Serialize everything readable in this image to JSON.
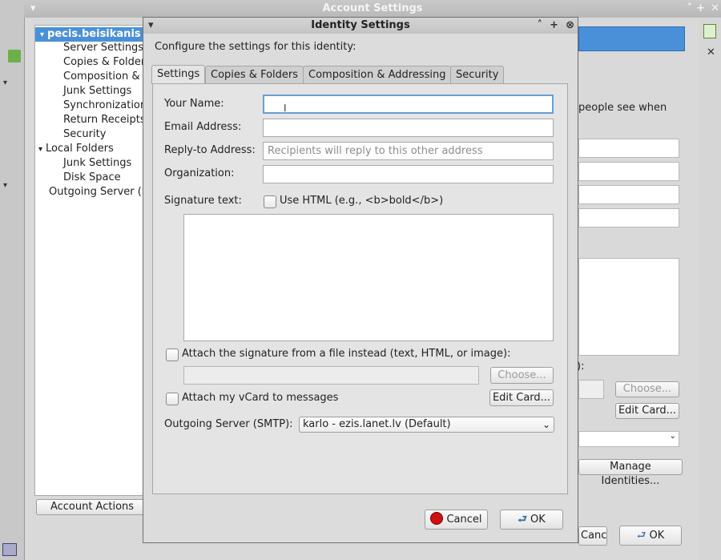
{
  "background_window": {
    "title": "Account Settings",
    "tree": [
      {
        "label": "pecis.beisikanis",
        "level": 0,
        "selected": true
      },
      {
        "label": "Server Settings",
        "level": 1
      },
      {
        "label": "Copies & Folders",
        "level": 1
      },
      {
        "label": "Composition &",
        "level": 1
      },
      {
        "label": "Junk Settings",
        "level": 1
      },
      {
        "label": "Synchronization",
        "level": 1
      },
      {
        "label": "Return Receipts",
        "level": 1
      },
      {
        "label": "Security",
        "level": 1
      },
      {
        "label": "Local Folders",
        "level": 0
      },
      {
        "label": "Junk Settings",
        "level": 1
      },
      {
        "label": "Disk Space",
        "level": 1
      },
      {
        "label": "Outgoing Server (S",
        "level": 0
      }
    ],
    "account_actions_label": "Account Actions",
    "people_see_text": "people see when",
    "partial_label": "):",
    "choose_label": "Choose...",
    "edit_card_label": "Edit Card...",
    "manage_identities_label": "Manage Identities...",
    "cancel_label": "Cancel",
    "ok_label": "OK"
  },
  "dialog": {
    "title": "Identity Settings",
    "intro": "Configure the settings for this identity:",
    "tabs": [
      "Settings",
      "Copies & Folders",
      "Composition & Addressing",
      "Security"
    ],
    "active_tab": "Settings",
    "fields": {
      "your_name": {
        "label": "Your Name:",
        "value": ""
      },
      "email": {
        "label": "Email Address:",
        "value": ""
      },
      "reply_to": {
        "label": "Reply-to Address:",
        "value": "",
        "placeholder": "Recipients will reply to this other address"
      },
      "organization": {
        "label": "Organization:",
        "value": ""
      }
    },
    "signature_label": "Signature text:",
    "use_html_label": "Use HTML (e.g., <b>bold</b>)",
    "attach_sig_label": "Attach the signature from a file instead (text, HTML, or image):",
    "choose_label": "Choose...",
    "attach_vcard_label": "Attach my vCard to messages",
    "edit_card_label": "Edit Card...",
    "smtp_label": "Outgoing Server (SMTP):",
    "smtp_value": "karlo - ezis.lanet.lv (Default)",
    "cancel_label": "Cancel",
    "ok_label": "OK"
  },
  "colors": {
    "accent": "#4a90d9",
    "focus": "#6a9ed1",
    "cancel_icon": "#cc1111"
  }
}
